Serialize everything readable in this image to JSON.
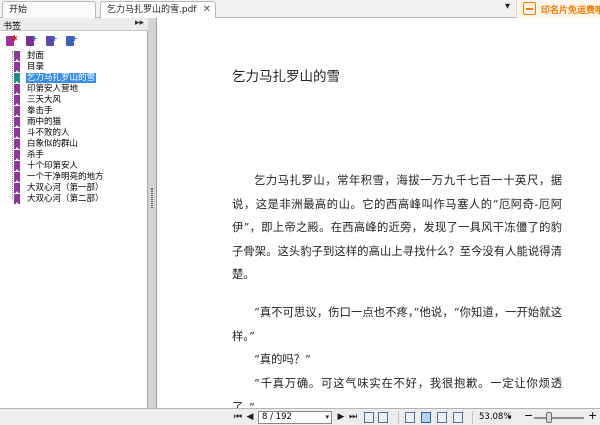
{
  "tabs": {
    "home_label": "开始",
    "doc_label": "乞力马扎罗山的雪.pdf",
    "close_glyph": "✕",
    "overflow_glyph": "▾"
  },
  "ad": {
    "text": "印名片免运费哦"
  },
  "sidebar": {
    "title": "书签",
    "collapse_glyph": "▸▸",
    "close_glyph": "×",
    "items": [
      {
        "label": "封面"
      },
      {
        "label": "目录"
      },
      {
        "label": "乞力马扎罗山的雪",
        "selected": true
      },
      {
        "label": "印第安人营地"
      },
      {
        "label": "三天大风"
      },
      {
        "label": "拳击手"
      },
      {
        "label": "雨中的猫"
      },
      {
        "label": "斗不败的人"
      },
      {
        "label": "白象似的群山"
      },
      {
        "label": "杀手"
      },
      {
        "label": "十个印第安人"
      },
      {
        "label": "一个干净明亮的地方"
      },
      {
        "label": "大双心河（第一部）"
      },
      {
        "label": "大双心河（第二部）"
      }
    ]
  },
  "document": {
    "title": "乞力马扎罗山的雪",
    "paragraphs": [
      "乞力马扎罗山，常年积雪，海拔一万九千七百一十英尺，据说，这是非洲最高的山。它的西高峰叫作马塞人的“厄阿奇-厄阿伊”，即上帝之殿。在西高峰的近旁，发现了一具风干冻僵了的豹子骨架。这头豹子到这样的高山上寻找什么？至今没有人能说得清楚。",
      "“真不可思议，伤口一点也不疼，”他说，“你知道，一开始就这样。”",
      "“真的吗？”",
      "“千真万确。可这气味实在不好，我很抱歉。一定让你烦透了。”"
    ]
  },
  "statusbar": {
    "page_value": "8 / 192",
    "zoom_value": "53.08%",
    "first_glyph": "⏮",
    "prev_glyph": "◀",
    "next_glyph": "▶",
    "last_glyph": "⏭",
    "drop_glyph": "▾",
    "minus_glyph": "−",
    "plus_glyph": "+"
  },
  "colors": {
    "accent": "#3a8ee6",
    "bookmark": "#8a3a96",
    "ad_orange": "#f07a00"
  }
}
